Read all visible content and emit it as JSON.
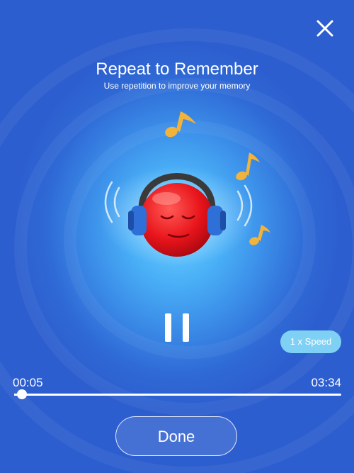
{
  "header": {
    "title": "Repeat to Remember",
    "subtitle": "Use repetition to improve your memory"
  },
  "icons": {
    "close": "close-icon",
    "emoji": "red-smiley-with-headphones",
    "notes": "music-note-icon",
    "pause": "pause-icon"
  },
  "player": {
    "elapsed": "00:05",
    "duration": "03:34",
    "progress_fraction": 0.024,
    "speed_label": "1 x Speed",
    "state": "playing"
  },
  "footer": {
    "done_label": "Done"
  },
  "colors": {
    "background_center": "#6fd2ff",
    "background_edge": "#2d5ecf",
    "speed_button": "#7fd0f5",
    "emoji": "#e8141b",
    "headphones": "#2f6fd8",
    "notes": "#f2b33a"
  }
}
